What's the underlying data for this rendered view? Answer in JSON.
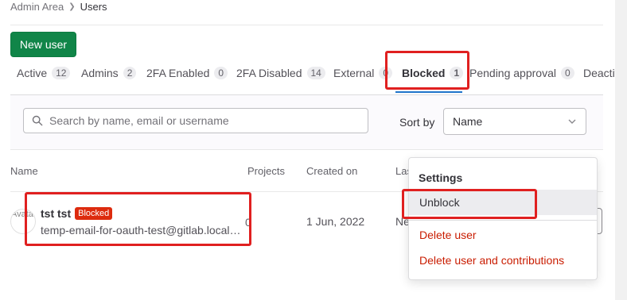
{
  "breadcrumb": {
    "items": [
      "Admin Area",
      "Users"
    ]
  },
  "new_user_label": "New user",
  "tabs": [
    {
      "label": "Active",
      "count": "12"
    },
    {
      "label": "Admins",
      "count": "2"
    },
    {
      "label": "2FA Enabled",
      "count": "0"
    },
    {
      "label": "2FA Disabled",
      "count": "14"
    },
    {
      "label": "External",
      "count": "0"
    },
    {
      "label": "Blocked",
      "count": "1"
    },
    {
      "label": "Pending approval",
      "count": "0"
    },
    {
      "label": "Deactivated",
      "count": ""
    }
  ],
  "search": {
    "placeholder": "Search by name, email or username"
  },
  "sort": {
    "label": "Sort by",
    "selected": "Name"
  },
  "table": {
    "headers": [
      "Name",
      "Projects",
      "Created on",
      "Last activity"
    ],
    "rows": [
      {
        "avatar_alt": "Avatar",
        "name": "tst tst",
        "badge": "Blocked",
        "email": "temp-email-for-oauth-test@gitlab.localhost",
        "projects": "0",
        "created_on": "1 Jun, 2022",
        "last_activity": "Never"
      }
    ]
  },
  "menu": {
    "header": "Settings",
    "items": [
      "Unblock",
      "Delete user",
      "Delete user and contributions"
    ]
  },
  "colors": {
    "primary_button": "#108548",
    "active_tab_underline": "#1f75cb",
    "blocked_badge": "#dd2b0e",
    "danger_text": "#c91c00",
    "highlight_annotation": "#e02020"
  }
}
